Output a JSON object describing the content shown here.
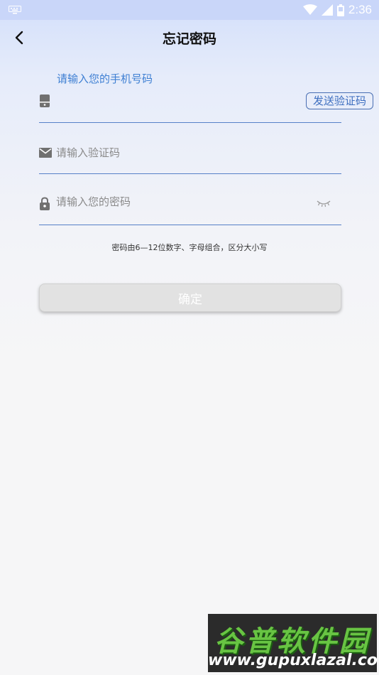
{
  "status_bar": {
    "time": "2:36"
  },
  "header": {
    "title": "忘记密码"
  },
  "phone": {
    "floating_label": "请输入您的手机号码",
    "value": "",
    "send_code_label": "发送验证码"
  },
  "code": {
    "placeholder": "请输入验证码",
    "value": ""
  },
  "password": {
    "placeholder": "请输入您的密码",
    "value": ""
  },
  "hint": "密码由6—12位数字、字母组合，区分大小写",
  "confirm_label": "确定",
  "watermark": {
    "top": "谷普软件园",
    "bottom": "www.gupuxlazal.com"
  },
  "colors": {
    "accent": "#3e7fd3",
    "underline": "#5680c8",
    "button_disabled": "#e2e2e2",
    "status_bar": "#c9d6f9"
  }
}
